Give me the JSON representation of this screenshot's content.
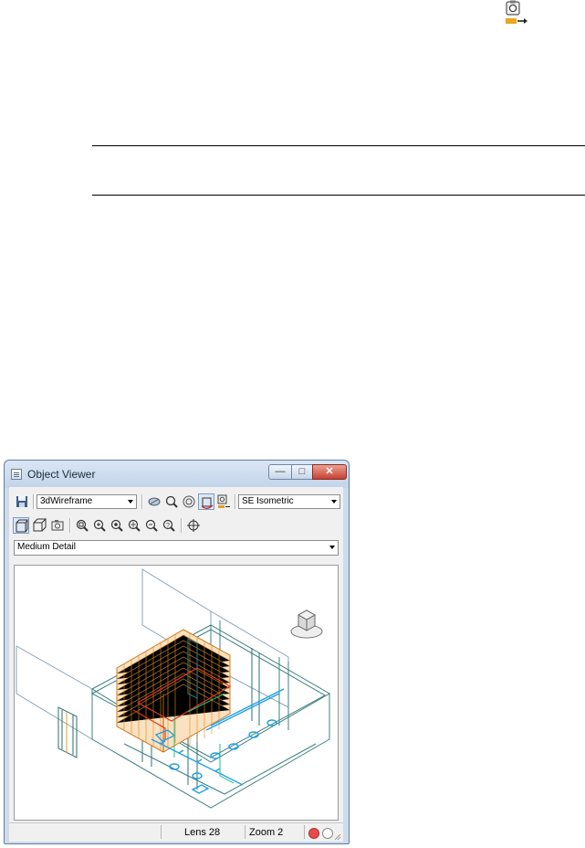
{
  "window": {
    "title": "Object Viewer",
    "caption_buttons": {
      "minimize": "—",
      "maximize": "□",
      "close": "✕"
    }
  },
  "toolbar1": {
    "icons": [
      "save-icon",
      "visual-style-dropdown",
      "orbit-icon",
      "zoom-realtime-icon",
      "zoom-extents-icon",
      "continuous-orbit-icon",
      "camera-options-icon",
      "view-dropdown"
    ],
    "visual_style": "3dWireframe",
    "view": "SE Isometric"
  },
  "toolbar2": {
    "icons": [
      "perspective-icon",
      "parallel-icon",
      "camera-icon",
      "zoom-window-icon",
      "zoom-in-icon",
      "zoom-object-icon",
      "zoom-center-icon",
      "zoom-out-icon",
      "zoom-previous-icon",
      "pan-icon"
    ]
  },
  "detail_level": "Medium Detail",
  "status": {
    "lens": "Lens 28",
    "zoom": "Zoom 2",
    "indicators": [
      "#e84b4b",
      "#ffffff"
    ]
  },
  "top_icon": "camera-export-icon",
  "colors": {
    "accent": "#d08020",
    "wire": "#4a8c8c",
    "pipe": "#1ea0e6",
    "highlight": "#e03a1a"
  }
}
